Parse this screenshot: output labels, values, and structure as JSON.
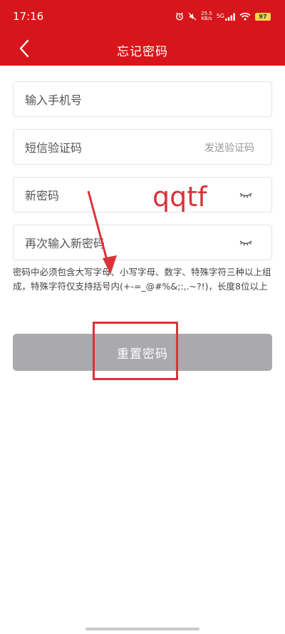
{
  "status_bar": {
    "time": "17:16",
    "network_speed_value": "25.5",
    "network_speed_unit": "KB/s",
    "signal_label": "5G",
    "battery": "97",
    "icons": [
      "alarm-icon",
      "mute-icon",
      "signal-icon",
      "wifi-icon",
      "battery-icon"
    ]
  },
  "header": {
    "title": "忘记密码",
    "back_icon": "chevron-left-icon",
    "background_color": "#d7161b"
  },
  "form": {
    "phone_placeholder": "输入手机号",
    "sms_code_placeholder": "短信验证码",
    "send_code_label": "发送验证码",
    "new_password_placeholder": "新密码",
    "confirm_password_placeholder": "再次输入新密码",
    "password_hint": "密码中必须包含大写字母、小写字母、数字、特殊字符三种以上组成，特殊字符仅支持括号内(+-=_@#%&;:,.~?!)，长度8位以上",
    "eye_icon": "eye-closed-icon",
    "reset_button": "重置密码",
    "button_color": "#a9a9ae"
  },
  "annotation": {
    "text": "qqtf",
    "color": "#d8333a"
  }
}
